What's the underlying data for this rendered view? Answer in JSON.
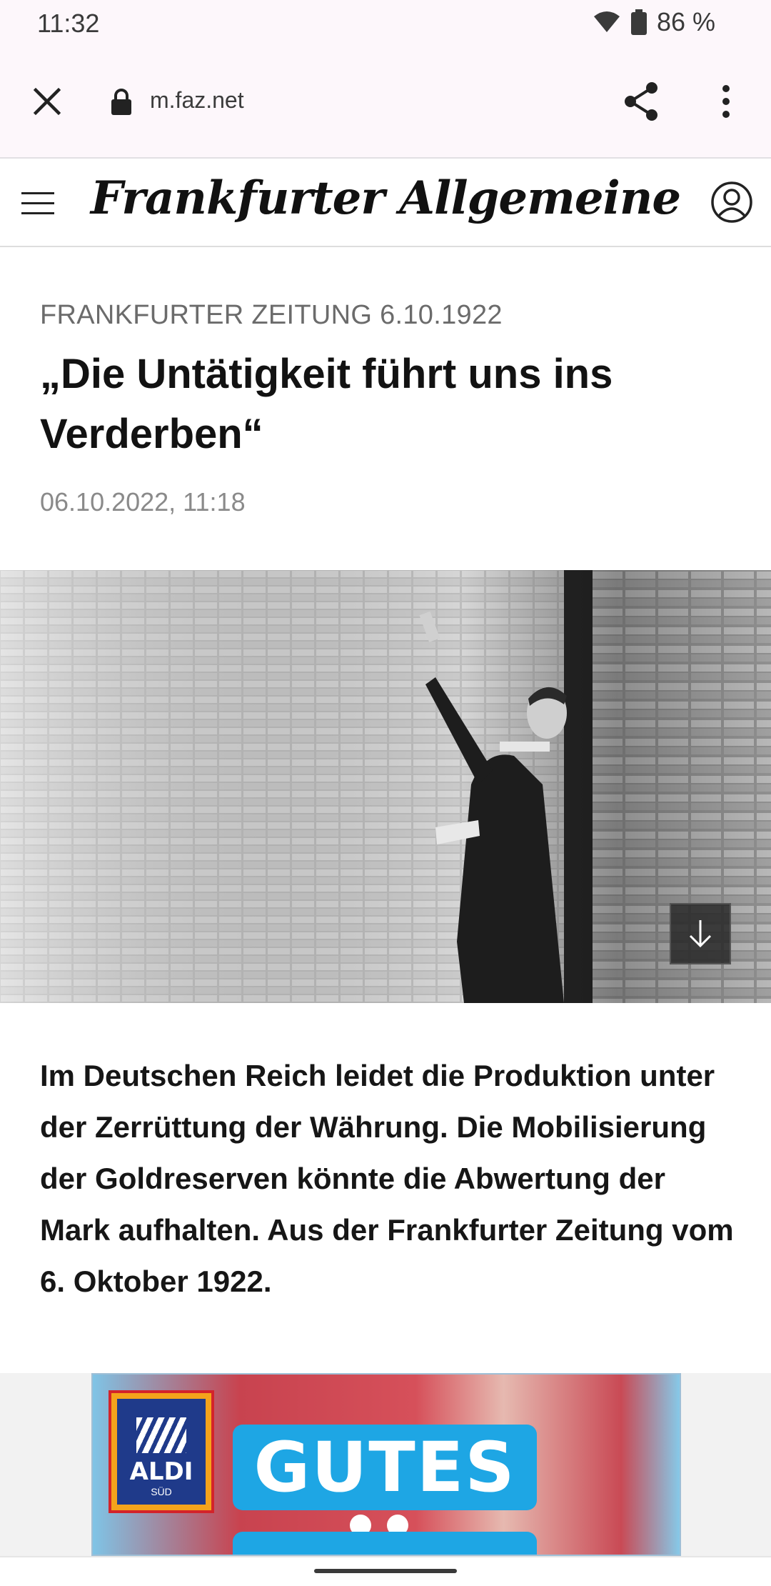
{
  "status_bar": {
    "time": "11:32",
    "battery": "86 %"
  },
  "browser": {
    "url": "m.faz.net"
  },
  "site": {
    "logo_text": "Frankfurter Allgemeine"
  },
  "article": {
    "kicker": "FRANKFURTER ZEITUNG 6.10.1922",
    "headline": "„Die Untätigkeit führt uns ins Verderben“",
    "dateline": "06.10.2022, 11:18",
    "teaser": "Im Deutschen Reich leidet die Produktion unter der Zerrüttung der Währung. Die Mobilisierung der Goldreserven könnte die Abwertung der Mark aufhalten. Aus der Frankfurter Zeitung vom 6. Oktober 1922."
  },
  "ad": {
    "brand": "ALDI",
    "brand_sub": "SÜD",
    "headline": "GUTES",
    "colors": {
      "brand_blue": "#1ea6e4",
      "logo_navy": "#1f3a8a",
      "logo_orange": "#f4a31b"
    }
  },
  "icons": {
    "close": "close-icon",
    "lock": "lock-icon",
    "share": "share-icon",
    "menu": "more-vert-icon",
    "hamburger": "hamburger-icon",
    "account": "account-icon",
    "download": "arrow-down-icon",
    "wifi": "wifi-icon",
    "battery": "battery-icon"
  }
}
